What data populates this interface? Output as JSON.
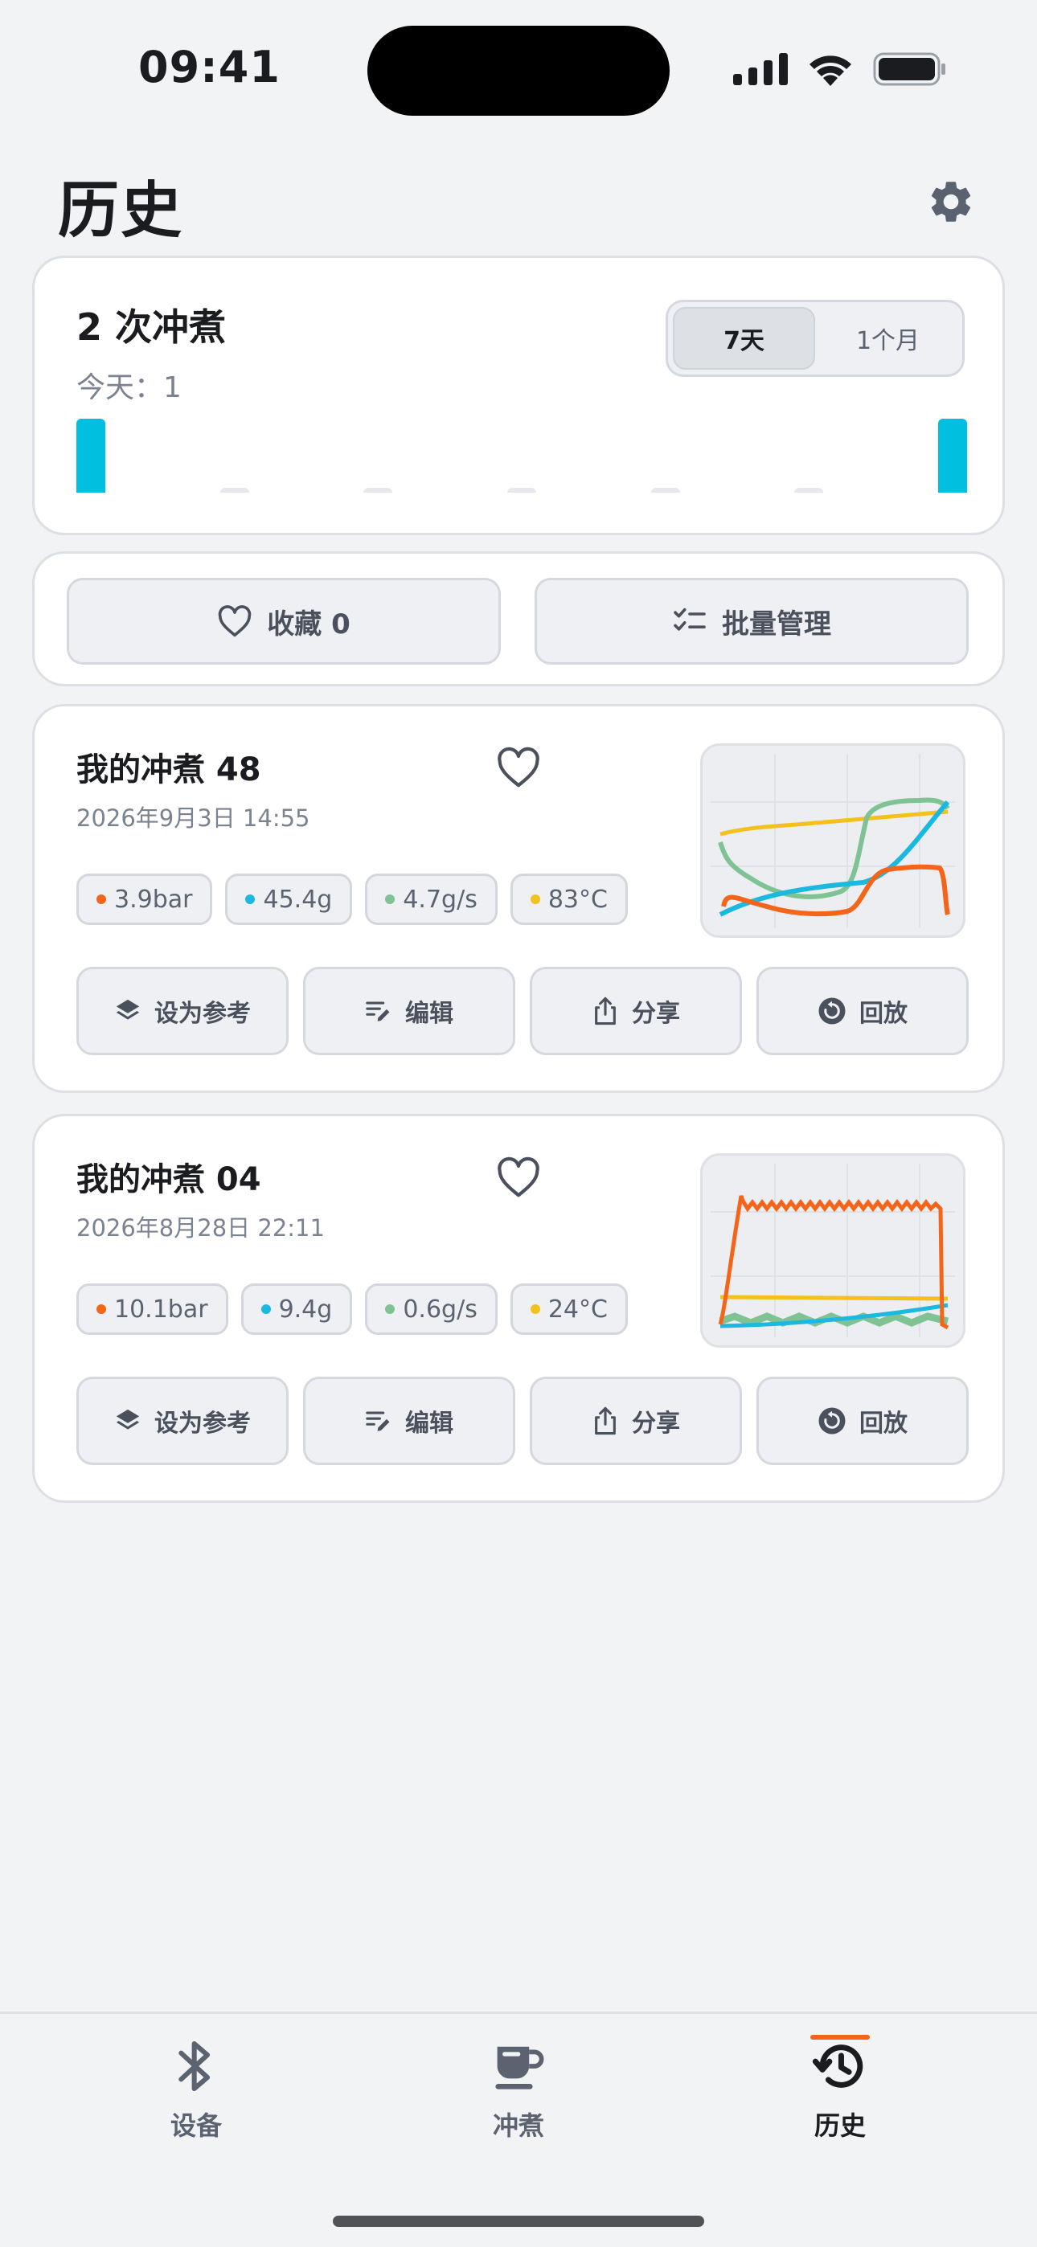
{
  "status_bar": {
    "time": "09:41"
  },
  "header": {
    "title": "历史"
  },
  "summary": {
    "count_label": "2 次冲煮",
    "today_label": "今天：1",
    "range_options": [
      "7天",
      "1个月"
    ],
    "selected_range": "7天",
    "daily_counts": [
      1,
      0,
      0,
      0,
      0,
      0,
      1
    ]
  },
  "actions": {
    "favorites_label": "收藏 0",
    "batch_label": "批量管理"
  },
  "brews": [
    {
      "name": "我的冲煮 48",
      "date": "2026年9月3日 14:55",
      "metrics": {
        "pressure": "3.9bar",
        "weight": "45.4g",
        "flow": "4.7g/s",
        "temp": "83°C"
      },
      "buttons": {
        "reference": "设为参考",
        "edit": "编辑",
        "share": "分享",
        "replay": "回放"
      }
    },
    {
      "name": "我的冲煮 04",
      "date": "2026年8月28日 22:11",
      "metrics": {
        "pressure": "10.1bar",
        "weight": "9.4g",
        "flow": "0.6g/s",
        "temp": "24°C"
      },
      "buttons": {
        "reference": "设为参考",
        "edit": "编辑",
        "share": "分享",
        "replay": "回放"
      }
    }
  ],
  "tabs": [
    {
      "label": "设备",
      "icon": "bluetooth-icon",
      "active": false
    },
    {
      "label": "冲煮",
      "icon": "coffee-cup-icon",
      "active": false
    },
    {
      "label": "历史",
      "icon": "history-icon",
      "active": true
    }
  ],
  "colors": {
    "pressure": "#f4651a",
    "weight": "#1bb8e0",
    "flow": "#7fc294",
    "temp": "#f2c11d",
    "accent": "#f4651a"
  }
}
